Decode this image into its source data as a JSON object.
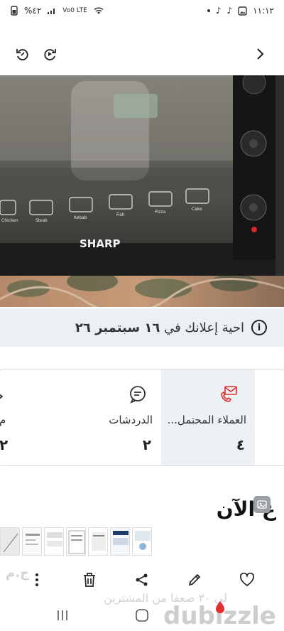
{
  "status_bar": {
    "time": "١١:١٢",
    "battery": "%٤٢",
    "network": "Vo0 LTE",
    "icons": [
      "gallery-icon",
      "tiktok-icon",
      "tiktok-icon",
      "dot-icon",
      "wifi-icon",
      "signal-icon",
      "battery-icon"
    ]
  },
  "top_nav": {
    "icons": [
      "rotate-ccw-icon",
      "rotate-cw-icon",
      "chevron-right-icon"
    ]
  },
  "photo": {
    "brand": "SHARP",
    "cooking_modes": [
      "Chicken",
      "Steak",
      "Kebab",
      "Fish",
      "Pizza",
      "Cake"
    ]
  },
  "expiry_banner": {
    "prefix": "احية إعلانك في ",
    "date": "١٦ سبتمبر ٢٦",
    "icon": "info-icon"
  },
  "stats": [
    {
      "label": "العملاء المحتمل...",
      "value": "٤",
      "icon": "phone-envelope-icon"
    },
    {
      "label": "الدردشات",
      "value": "٢",
      "icon": "chat-icon"
    },
    {
      "label": "م",
      "value": "٢",
      "icon": "partial-icon"
    }
  ],
  "section_heading": "ع الآن",
  "faded_text": {
    "price": "ج.م",
    "note": "لى ٣٠ ضعفا من المشترين"
  },
  "action_bar": {
    "icons": [
      "more-vertical-icon",
      "delete-icon",
      "share-icon",
      "edit-icon",
      "heart-icon"
    ]
  },
  "watermark": "dubizzle",
  "colors": {
    "accent_red": "#e0322f",
    "banner_bg": "#eaf0f4",
    "selected_bg": "#eef1f4"
  }
}
